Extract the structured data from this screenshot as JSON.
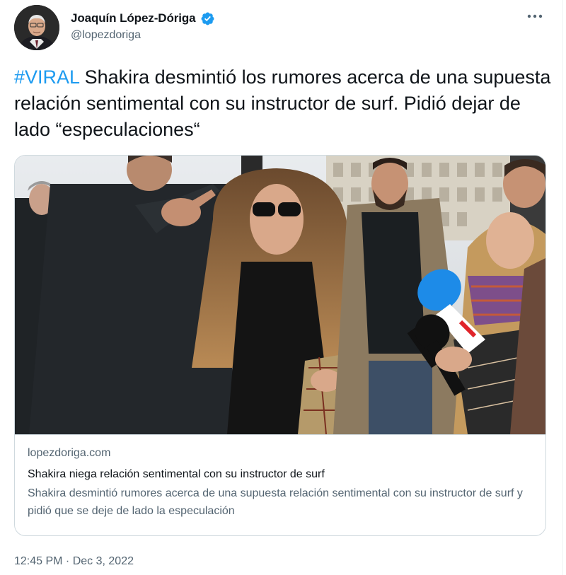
{
  "author": {
    "display_name": "Joaquín López-Dóriga",
    "handle": "@lopezdoriga",
    "verified": true,
    "avatar_icon": "avatar-portrait"
  },
  "menu": {
    "more_icon": "more-horizontal-icon"
  },
  "tweet": {
    "hashtag": "#VIRAL",
    "text": " Shakira desmintió los rumores acerca de una supuesta relación sentimental con su instructor de surf. Pidió dejar de lado “especulaciones“"
  },
  "card": {
    "image_alt_icon": "news-photo",
    "domain": "lopezdoriga.com",
    "title": "Shakira niega relación sentimental con su instructor de surf",
    "description": "Shakira desmintió rumores acerca de una supuesta relación sentimental con su instructor de surf y pidió que se deje de lado la especulación"
  },
  "meta": {
    "timestamp": "12:45 PM · Dec 3, 2022"
  },
  "colors": {
    "accent": "#1d9bf0",
    "text_primary": "#0f1419",
    "text_secondary": "#536471",
    "border": "#cfd9de"
  }
}
